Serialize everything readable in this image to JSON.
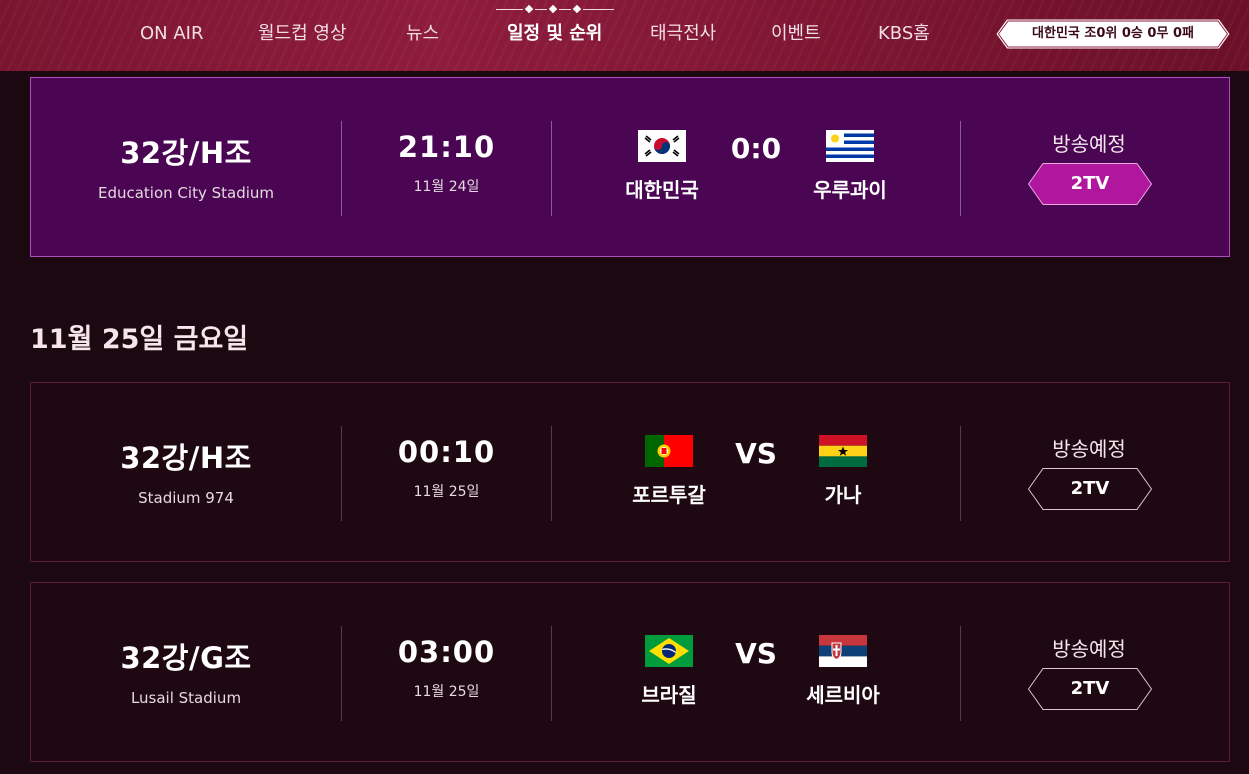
{
  "nav": {
    "items": [
      "ON AIR",
      "월드컵 영상",
      "뉴스",
      "일정 및 순위",
      "태극전사",
      "이벤트",
      "KBS홈"
    ],
    "active_index": 3,
    "record_badge": "대한민국 조0위 0승 0무 0패"
  },
  "schedule": {
    "date_heading_2": "11월 25일 금요일",
    "matches": [
      {
        "round": "32강/H조",
        "venue": "Education City Stadium",
        "time": "21:10",
        "date": "11월 24일",
        "home_team": "대한민국",
        "home_flag": "korea-flag",
        "score": "0:0",
        "away_team": "우루과이",
        "away_flag": "uruguay-flag",
        "broadcast_status": "방송예정",
        "channel": "2TV",
        "highlighted": true
      },
      {
        "round": "32강/H조",
        "venue": "Stadium 974",
        "time": "00:10",
        "date": "11월 25일",
        "home_team": "포르투갈",
        "home_flag": "portugal-flag",
        "score": "VS",
        "away_team": "가나",
        "away_flag": "ghana-flag",
        "broadcast_status": "방송예정",
        "channel": "2TV",
        "highlighted": false
      },
      {
        "round": "32강/G조",
        "venue": "Lusail Stadium",
        "time": "03:00",
        "date": "11월 25일",
        "home_team": "브라질",
        "home_flag": "brazil-flag",
        "score": "VS",
        "away_team": "세르비아",
        "away_flag": "serbia-flag",
        "broadcast_status": "방송예정",
        "channel": "2TV",
        "highlighted": false
      }
    ]
  },
  "colors": {
    "nav_bg": "#8e1c3c",
    "page_bg": "#1c0810",
    "highlight_card_bg": "#4a0653",
    "highlight_button": "#b0169e"
  }
}
